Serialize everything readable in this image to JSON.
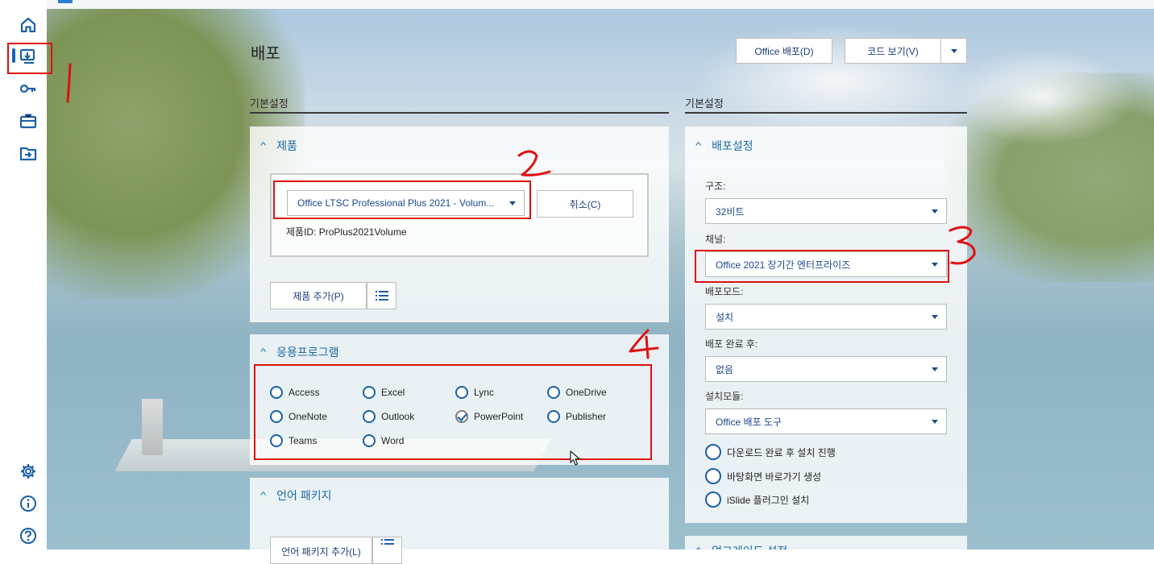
{
  "nav": {
    "items": [
      {
        "id": "home",
        "icon": "home-icon"
      },
      {
        "id": "deploy",
        "icon": "deploy-icon",
        "active": true
      },
      {
        "id": "activation",
        "icon": "key-icon"
      },
      {
        "id": "toolbox",
        "icon": "toolbox-icon"
      },
      {
        "id": "import",
        "icon": "folder-import-icon"
      }
    ],
    "bottom": [
      {
        "id": "settings",
        "icon": "gear-icon"
      },
      {
        "id": "about",
        "icon": "info-icon"
      },
      {
        "id": "help",
        "icon": "help-icon"
      }
    ]
  },
  "page": {
    "title": "배포",
    "actions": {
      "deploy_label": "Office 배포(D)",
      "view_code_label": "코드 보기(V)"
    }
  },
  "left": {
    "section_title": "기본설정",
    "product_card": {
      "heading": "제품",
      "selected_product": "Office LTSC Professional Plus 2021 - Volum...",
      "cancel_label": "취소(C)",
      "product_id": "제품ID: ProPlus2021Volume",
      "add_product_label": "제품 추가(P)"
    },
    "apps_card": {
      "heading": "응용프로그램",
      "apps": [
        {
          "name": "Access",
          "checked": false
        },
        {
          "name": "Excel",
          "checked": false
        },
        {
          "name": "Lync",
          "checked": false
        },
        {
          "name": "OneDrive",
          "checked": false
        },
        {
          "name": "OneNote",
          "checked": false
        },
        {
          "name": "Outlook",
          "checked": false
        },
        {
          "name": "PowerPoint",
          "checked": true
        },
        {
          "name": "Publisher",
          "checked": false
        },
        {
          "name": "Teams",
          "checked": false
        },
        {
          "name": "Word",
          "checked": false
        }
      ]
    },
    "lang_card": {
      "heading": "언어 패키지",
      "add_language_label": "언어 패키지 추가(L)"
    }
  },
  "right": {
    "section_title": "기본설정",
    "deploy_card": {
      "heading": "배포설정",
      "arch_label": "구조:",
      "arch_value": "32비트",
      "channel_label": "채널:",
      "channel_value": "Office 2021 장기간 엔터프라이즈",
      "mode_label": "배포모드:",
      "mode_value": "설치",
      "after_label": "배포 완료 후:",
      "after_value": "없음",
      "module_label": "설치모듈:",
      "module_value": "Office 배포 도구",
      "options": [
        {
          "label": "다운로드 완료 후 설치 진행",
          "checked": false
        },
        {
          "label": "바탕화면 바로가기 생성",
          "checked": false
        },
        {
          "label": "iSlide 플러그인 설치",
          "checked": false
        }
      ]
    },
    "next_card_heading": "업그레이드 설정"
  },
  "annotations": {
    "box_color": "#e01010",
    "marks": [
      "1",
      "2",
      "3",
      "4"
    ]
  }
}
